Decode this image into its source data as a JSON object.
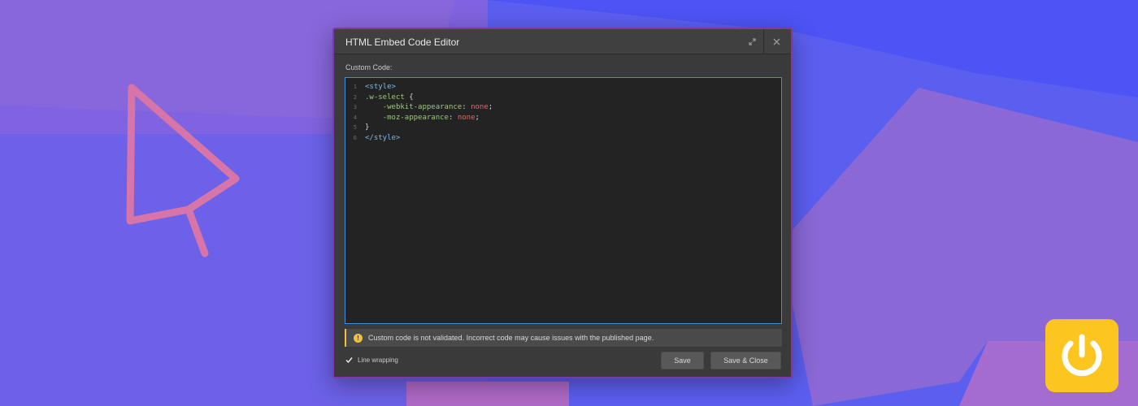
{
  "modal": {
    "title": "HTML Embed Code Editor",
    "field_label": "Custom Code:",
    "code_lines": [
      {
        "n": "1",
        "indent": "",
        "parts": [
          {
            "t": "<style>",
            "c": "tag"
          }
        ]
      },
      {
        "n": "2",
        "indent": "",
        "parts": [
          {
            "t": ".w-select",
            "c": "sel"
          },
          {
            "t": " {",
            "c": "punct"
          }
        ]
      },
      {
        "n": "3",
        "indent": "    ",
        "parts": [
          {
            "t": "-webkit-appearance",
            "c": "prop"
          },
          {
            "t": ": ",
            "c": "punct"
          },
          {
            "t": "none",
            "c": "val"
          },
          {
            "t": ";",
            "c": "punct"
          }
        ]
      },
      {
        "n": "4",
        "indent": "    ",
        "parts": [
          {
            "t": "-moz-appearance",
            "c": "prop"
          },
          {
            "t": ": ",
            "c": "punct"
          },
          {
            "t": "none",
            "c": "val"
          },
          {
            "t": ";",
            "c": "punct"
          }
        ]
      },
      {
        "n": "5",
        "indent": "",
        "parts": [
          {
            "t": "}",
            "c": "punct"
          }
        ]
      },
      {
        "n": "6",
        "indent": "",
        "parts": [
          {
            "t": "</style>",
            "c": "tag"
          }
        ]
      }
    ],
    "warning": "Custom code is not validated. Incorrect code may cause issues with the published page.",
    "line_wrapping": {
      "label": "Line wrapping",
      "checked": true
    },
    "buttons": {
      "save": "Save",
      "save_close": "Save & Close"
    },
    "icons": {
      "expand": "expand-icon",
      "close": "close-icon",
      "warning": "info-icon",
      "checkbox": "checkmark-icon"
    }
  },
  "colors": {
    "accent_border": "#3c8fd8",
    "warning_accent": "#f0c23a",
    "badge_bg": "#fdc51f",
    "modal_frame": "#7b3aa6"
  },
  "decor": {
    "cursor": "cursor-arrow-icon",
    "badge": "power-icon"
  }
}
